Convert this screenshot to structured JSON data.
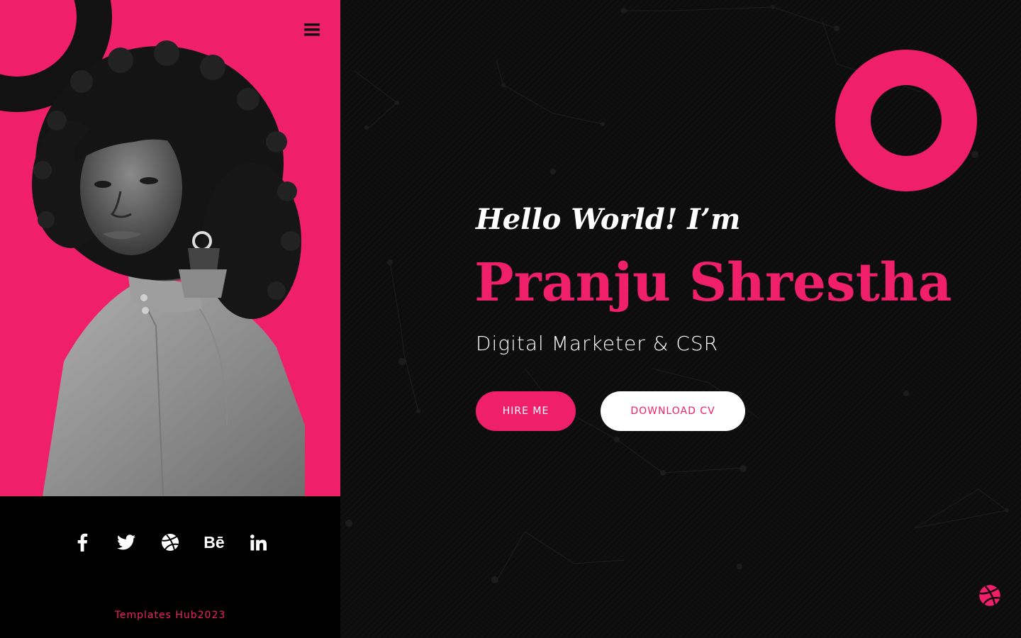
{
  "colors": {
    "accent": "#f01f69",
    "dark": "#0e0e0e",
    "black": "#000000",
    "white": "#ffffff"
  },
  "nav": {
    "menu_icon": "hamburger-menu-icon"
  },
  "social": [
    {
      "name": "facebook",
      "icon": "facebook-icon"
    },
    {
      "name": "twitter",
      "icon": "twitter-icon"
    },
    {
      "name": "dribbble",
      "icon": "dribbble-icon"
    },
    {
      "name": "behance",
      "icon": "behance-icon",
      "glyph": "Bē"
    },
    {
      "name": "linkedin",
      "icon": "linkedin-icon"
    }
  ],
  "footer": {
    "text": "Templates Hub2023"
  },
  "hero": {
    "greeting": "Hello World! I’m",
    "name": "Pranju Shrestha",
    "role": "Digital Marketer & CSR",
    "hire_label": "HIRE ME",
    "cv_label": "DOWNLOAD CV"
  },
  "floating": {
    "icon": "dribbble-icon"
  }
}
